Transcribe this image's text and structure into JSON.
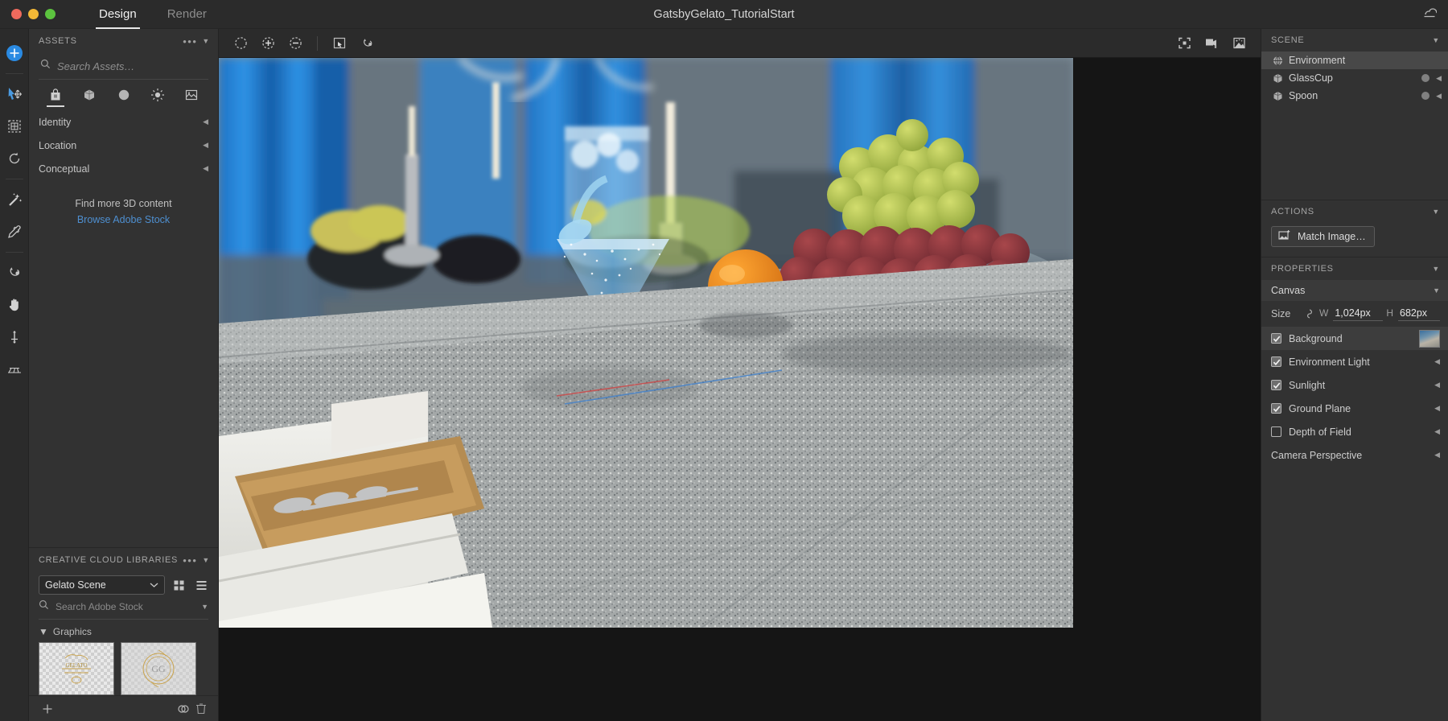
{
  "titlebar": {
    "document_title": "GatsbyGelato_TutorialStart",
    "tabs": [
      {
        "label": "Design",
        "active": true
      },
      {
        "label": "Render",
        "active": false
      }
    ],
    "window_controls": [
      "close",
      "minimize",
      "maximize"
    ],
    "right_icon": "creative-cloud-icon"
  },
  "toolbar": {
    "tools": [
      {
        "name": "object-add-tool",
        "icon": "plus-circle-icon",
        "active": true
      },
      {
        "name": "select-move-tool",
        "icon": "select-move-icon",
        "active": false
      },
      {
        "name": "scale-tool",
        "icon": "scale-box-icon",
        "active": false
      },
      {
        "name": "rotate-tool",
        "icon": "rotate-arrow-icon",
        "active": false
      },
      {
        "name": "magic-wand-tool",
        "icon": "magic-wand-icon",
        "active": false
      },
      {
        "name": "eyedropper-tool",
        "icon": "eyedropper-icon",
        "active": false
      },
      {
        "name": "material-drop-tool",
        "icon": "material-drop-icon",
        "active": false
      },
      {
        "name": "pan-tool",
        "icon": "hand-icon",
        "active": false
      },
      {
        "name": "anchor-tool",
        "icon": "anchor-icon",
        "active": false
      },
      {
        "name": "ground-plane-tool",
        "icon": "grid-plane-icon",
        "active": false
      }
    ]
  },
  "assets_panel": {
    "header": "ASSETS",
    "more_label": "•••",
    "search": {
      "placeholder": "Search Assets…",
      "value": "",
      "icon": "search-icon"
    },
    "category_tabs": [
      {
        "name": "models",
        "icon": "bag-icon",
        "active": true
      },
      {
        "name": "shapes",
        "icon": "cube-icon",
        "active": false
      },
      {
        "name": "materials",
        "icon": "material-sphere-icon",
        "active": false
      },
      {
        "name": "lights",
        "icon": "sun-icon",
        "active": false
      },
      {
        "name": "environments",
        "icon": "image-icon",
        "active": false
      }
    ],
    "rows": [
      {
        "label": "Identity"
      },
      {
        "label": "Location"
      },
      {
        "label": "Conceptual"
      }
    ],
    "find_more_text": "Find more 3D content",
    "stock_link": "Browse Adobe Stock",
    "link_color": "#4e8fd0"
  },
  "libraries_panel": {
    "header": "CREATIVE CLOUD LIBRARIES",
    "more_label": "•••",
    "selected_library": "Gelato Scene",
    "view_grid_icon": "grid-view-icon",
    "view_list_icon": "list-view-icon",
    "search": {
      "placeholder": "Search Adobe Stock",
      "value": "",
      "icon": "search-icon"
    },
    "group": {
      "label": "Graphics",
      "expanded": true
    },
    "thumbnails": [
      {
        "name": "graphic-thumb-1"
      },
      {
        "name": "graphic-thumb-2"
      }
    ],
    "footer": {
      "add_icon": "plus-icon",
      "cc_icon": "creative-cloud-icon",
      "delete_icon": "trash-icon"
    }
  },
  "viewport_toolbar": {
    "left_tools": [
      {
        "name": "select-marquee",
        "icon": "dashed-circle-icon"
      },
      {
        "name": "add-to-selection",
        "icon": "dashed-circle-plus-icon"
      },
      {
        "name": "subtract-from-selection",
        "icon": "dashed-circle-minus-icon"
      },
      {
        "name": "select-similar",
        "icon": "select-object-icon"
      },
      {
        "name": "select-material",
        "icon": "material-select-icon"
      }
    ],
    "right_tools": [
      {
        "name": "fit-to-screen",
        "icon": "fit-frame-icon"
      },
      {
        "name": "camera-view",
        "icon": "camera-image-icon"
      },
      {
        "name": "render-preview",
        "icon": "render-quality-icon"
      }
    ]
  },
  "scene_panel": {
    "header": "SCENE",
    "items": [
      {
        "label": "Environment",
        "icon": "globe-icon",
        "selected": true,
        "has_material": false,
        "has_arrow": false
      },
      {
        "label": "GlassCup",
        "icon": "cube-icon",
        "selected": false,
        "has_material": true,
        "has_arrow": true
      },
      {
        "label": "Spoon",
        "icon": "cube-icon",
        "selected": false,
        "has_material": true,
        "has_arrow": true
      }
    ]
  },
  "actions_panel": {
    "header": "ACTIONS",
    "match_image_label": "Match Image…",
    "match_image_icon": "match-image-icon"
  },
  "properties_panel": {
    "header": "PROPERTIES",
    "canvas": {
      "label": "Canvas",
      "size_label": "Size",
      "link_icon": "link-chain-icon",
      "width_key": "W",
      "width_value": "1,024px",
      "height_key": "H",
      "height_value": "682px"
    },
    "checkboxes": [
      {
        "label": "Background",
        "checked": true,
        "has_thumb": true,
        "has_arrow": false,
        "highlight": true
      },
      {
        "label": "Environment Light",
        "checked": true,
        "has_thumb": false,
        "has_arrow": true,
        "highlight": false
      },
      {
        "label": "Sunlight",
        "checked": true,
        "has_thumb": false,
        "has_arrow": true,
        "highlight": false
      },
      {
        "label": "Ground Plane",
        "checked": true,
        "has_thumb": false,
        "has_arrow": true,
        "highlight": false
      },
      {
        "label": "Depth of Field",
        "checked": false,
        "has_thumb": false,
        "has_arrow": true,
        "highlight": false
      }
    ],
    "camera_perspective": {
      "label": "Camera Perspective",
      "has_arrow": true
    }
  },
  "colors": {
    "panel_bg": "#323232",
    "chrome_bg": "#2b2b2b",
    "accent_blue": "#2a8ae2",
    "link_blue": "#4e8fd0",
    "selected_row": "#484848"
  }
}
